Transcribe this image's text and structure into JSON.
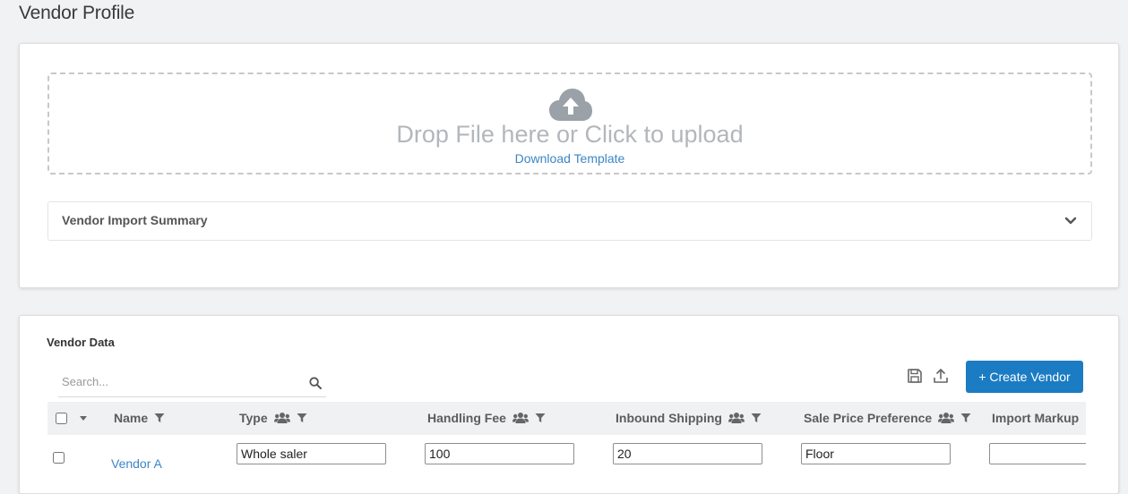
{
  "page": {
    "title": "Vendor Profile"
  },
  "upload": {
    "drop_text": "Drop File here or Click to upload",
    "download_link": "Download Template",
    "summary_label": "Vendor Import Summary"
  },
  "vendor_data": {
    "title": "Vendor Data",
    "search": {
      "placeholder": "Search...",
      "value": ""
    },
    "create_button": "+ Create Vendor",
    "columns": [
      {
        "label": "Name"
      },
      {
        "label": "Type"
      },
      {
        "label": "Handling Fee"
      },
      {
        "label": "Inbound Shipping"
      },
      {
        "label": "Sale Price Preference"
      },
      {
        "label": "Import Markup"
      }
    ],
    "rows": [
      {
        "name": "Vendor A",
        "type": "Whole saler",
        "handling_fee": "100",
        "inbound_shipping": "20",
        "sale_price_preference": "Floor",
        "import_markup": ""
      }
    ]
  },
  "icons": {
    "upload": "cloud-upload-icon",
    "summary_toggle": "chevron-down-icon",
    "search": "search-icon",
    "save": "save-icon",
    "export": "upload-icon",
    "group": "group-icon",
    "filter": "filter-icon"
  },
  "colors": {
    "accent": "#1b7cc3",
    "link": "#3b86c6",
    "page_bg": "#f1f2f3"
  }
}
